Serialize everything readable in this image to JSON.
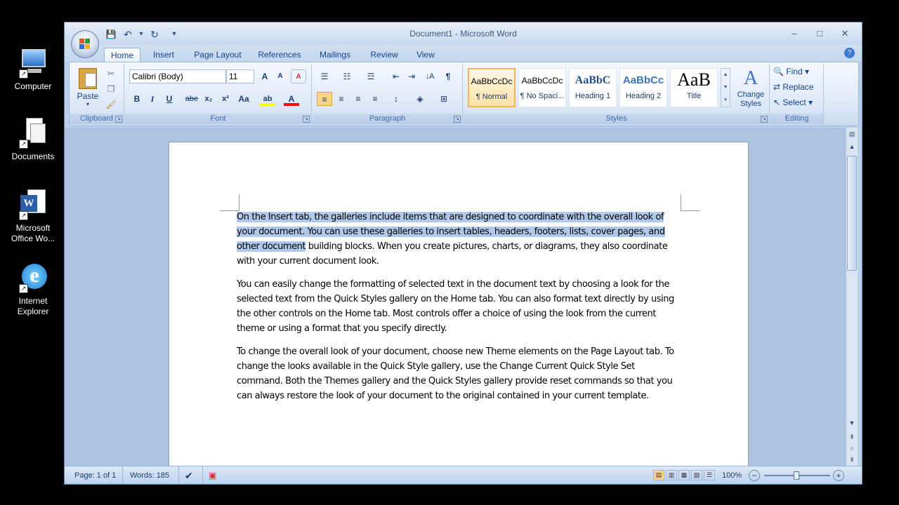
{
  "desktop": {
    "icons": [
      {
        "label": "Computer"
      },
      {
        "label": "Documents"
      },
      {
        "label": "Microsoft Office Wo..."
      },
      {
        "label": "Internet Explorer"
      }
    ]
  },
  "window": {
    "title": "Document1 - Microsoft Word",
    "controls": {
      "minimize": "–",
      "maximize": "□",
      "close": "✕"
    }
  },
  "qat": {
    "save": "💾",
    "undo": "↶",
    "undo_drop": "▾",
    "redo": "↻",
    "customize": "▾"
  },
  "tabs": [
    "Home",
    "Insert",
    "Page Layout",
    "References",
    "Mailings",
    "Review",
    "View"
  ],
  "ribbon": {
    "clipboard": {
      "label": "Clipboard",
      "paste": "Paste"
    },
    "font": {
      "label": "Font",
      "font_name": "Calibri (Body)",
      "font_size": "11",
      "grow": "A",
      "shrink": "A",
      "clear": "A",
      "bold": "B",
      "italic": "I",
      "underline": "U",
      "strike": "abe",
      "subscript": "x₂",
      "superscript": "x²",
      "change_case": "Aa",
      "highlight": "ab",
      "font_color": "A"
    },
    "paragraph": {
      "label": "Paragraph"
    },
    "styles": {
      "label": "Styles",
      "items": [
        {
          "preview": "AaBbCcDc",
          "name": "¶ Normal"
        },
        {
          "preview": "AaBbCcDc",
          "name": "¶ No Spaci..."
        },
        {
          "preview": "AaBbC",
          "name": "Heading 1"
        },
        {
          "preview": "AaBbCc",
          "name": "Heading 2"
        },
        {
          "preview": "AaB",
          "name": "Title"
        }
      ],
      "change_styles": "Change Styles"
    },
    "editing": {
      "label": "Editing",
      "find": "Find",
      "replace": "Replace",
      "select": "Select"
    }
  },
  "document": {
    "para1_selected": "On the Insert tab, the galleries include items that are designed to coordinate with the overall look of your document. You can use these galleries to insert tables, headers, footers, lists, cover pages, and other document",
    "para1_rest": " building blocks. When you create pictures, charts, or diagrams, they also coordinate with your current document look.",
    "para2": "You can easily change the formatting of selected text in the document text by choosing a look for the selected text from the Quick Styles gallery on the Home tab. You can also format text directly by using the other controls on the Home tab. Most controls offer a choice of using the look from the current theme or using a format that you specify directly.",
    "para3": "To change the overall look of your document, choose new Theme elements on the Page Layout tab. To change the looks available in the Quick Style gallery, use the Change Current Quick Style Set command. Both the Themes gallery and the Quick Styles gallery provide reset commands so that you can always restore the look of your document to the original contained in your current template."
  },
  "statusbar": {
    "page": "Page: 1 of 1",
    "words": "Words: 185",
    "zoom": "100%",
    "zoom_out": "−",
    "zoom_in": "+"
  },
  "colors": {
    "accent": "#15428b",
    "selection": "#b0c9ea",
    "ribbon": "#dce8f7"
  }
}
